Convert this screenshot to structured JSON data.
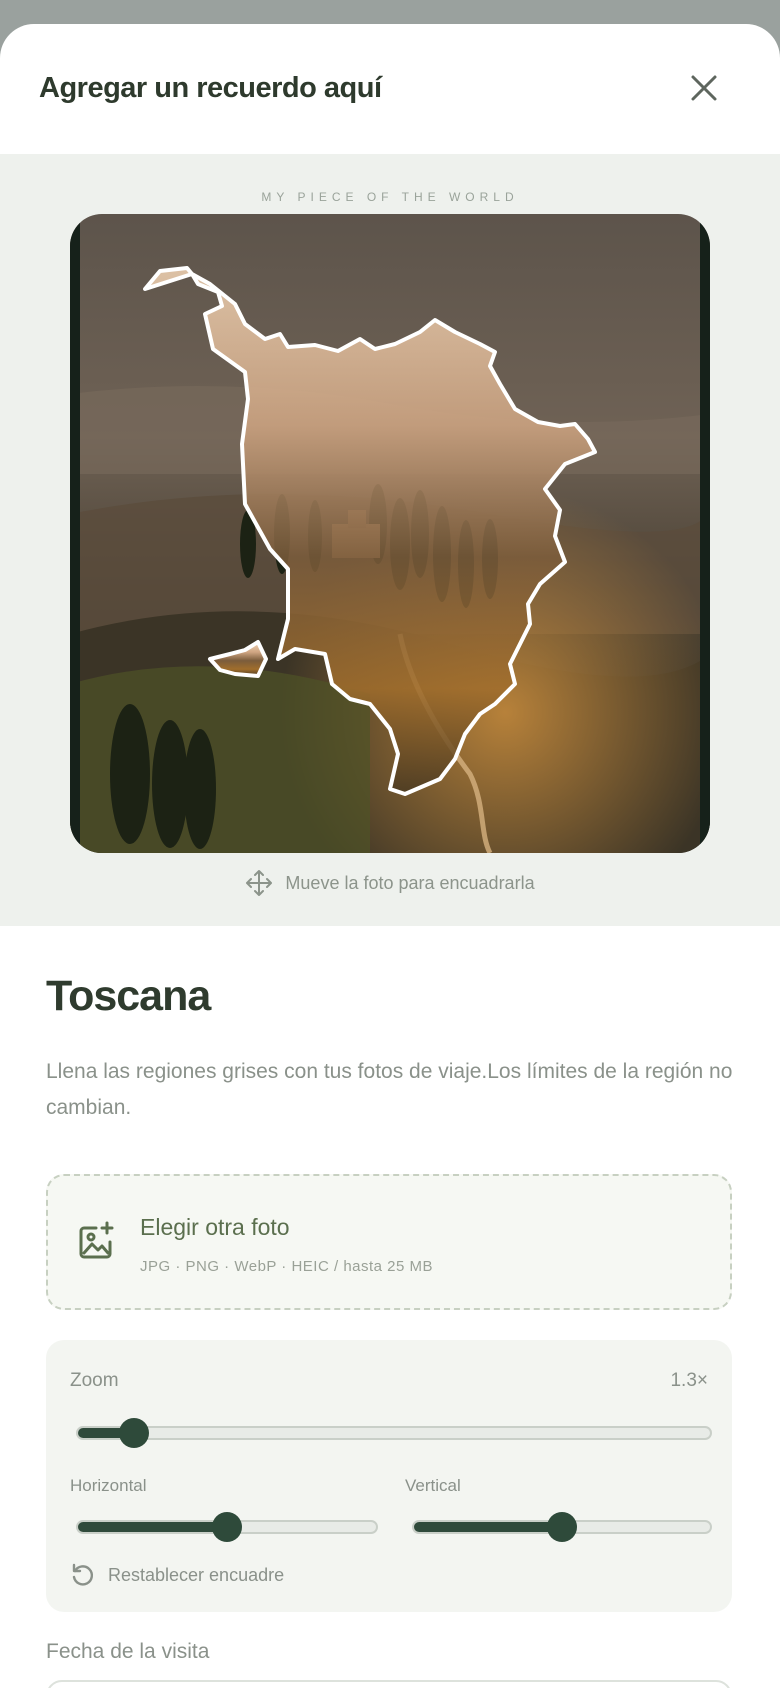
{
  "header": {
    "title": "Agregar un recuerdo aquí",
    "close_icon": "close-icon"
  },
  "preview": {
    "kicker": "MY PIECE OF THE WORLD",
    "drag_hint": "Mueve la foto para encuadrarla",
    "drag_icon": "move-arrows-icon"
  },
  "region": {
    "name": "Toscana",
    "description": "Llena las regiones grises con tus fotos de viaje.Los límites de la región no cambian."
  },
  "upload": {
    "label": "Elegir otra foto",
    "formats": "JPG · PNG · WebP · HEIC / hasta 25 MB",
    "icon": "image-add-icon"
  },
  "controls": {
    "zoom_label": "Zoom",
    "zoom_value": "1.3×",
    "zoom_level": 0.06,
    "horizontal_label": "Horizontal",
    "horizontal_level": 0.5,
    "vertical_label": "Vertical",
    "vertical_level": 0.5,
    "reset_label": "Restablecer encuadre",
    "reset_icon": "reset-icon"
  },
  "visit": {
    "date_label": "Fecha de la visita"
  },
  "colors": {
    "accent": "#2e4a3a",
    "title": "#2f3b2e",
    "muted": "#8a918a",
    "panel": "#eef1ed"
  }
}
